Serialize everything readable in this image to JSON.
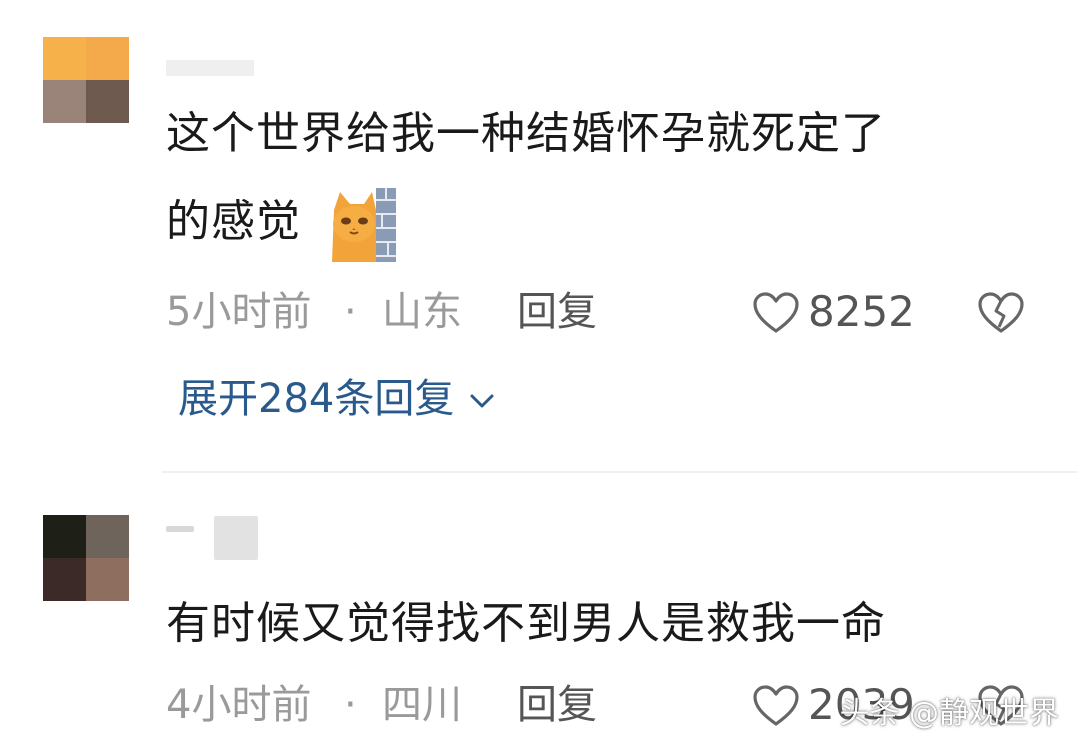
{
  "colors": {
    "text_primary": "#1a1a1a",
    "text_meta": "#9a9a9a",
    "reply_link": "#2a5a8c",
    "divider": "#f0f0f0",
    "background": "#ffffff"
  },
  "comments": [
    {
      "text_line1": "这个世界给我一种结婚怀孕就死定了",
      "text_line2": "的感觉",
      "emoji": "cat-peeking-from-wall-emoji",
      "time": "5小时前",
      "separator": "·",
      "location": "山东",
      "reply_label": "回复",
      "likes": "8252",
      "expand_replies": "展开284条回复"
    },
    {
      "text_line1": "有时候又觉得找不到男人是救我一命",
      "time": "4小时前",
      "separator": "·",
      "location": "四川",
      "reply_label": "回复",
      "likes": "2039"
    }
  ],
  "watermark": "头条 @静观世界"
}
